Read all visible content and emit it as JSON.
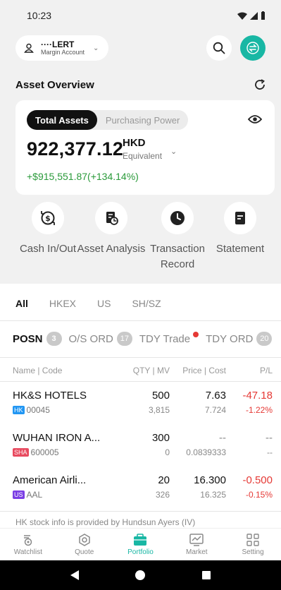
{
  "status": {
    "time": "10:23"
  },
  "account": {
    "name": "····LERT",
    "type": "Margin Account"
  },
  "overview": {
    "title": "Asset Overview",
    "tabs": [
      "Total Assets",
      "Purchasing Power"
    ],
    "amount": "922,377.12",
    "currency": "HKD",
    "equivalent": "Equivalent",
    "gain": "+$915,551.87(+134.14%)"
  },
  "actions": [
    {
      "label": "Cash In/Out",
      "icon": "cash-transfer-icon"
    },
    {
      "label": "Asset Analysis",
      "icon": "analysis-icon"
    },
    {
      "label": "Transaction Record",
      "icon": "clock-icon"
    },
    {
      "label": "Statement",
      "icon": "document-icon"
    }
  ],
  "market_tabs": [
    "All",
    "HKEX",
    "US",
    "SH/SZ"
  ],
  "sub_tabs": [
    {
      "label": "POSN",
      "count": "3"
    },
    {
      "label": "O/S ORD",
      "count": "17"
    },
    {
      "label": "TDY Trade",
      "count": ""
    },
    {
      "label": "TDY ORD",
      "count": "20"
    }
  ],
  "columns": {
    "name": "Name | Code",
    "qty": "QTY | MV",
    "price": "Price | Cost",
    "pl": "P/L"
  },
  "positions": [
    {
      "name": "HK&S HOTELS",
      "market": "HK",
      "code": "00045",
      "qty": "500",
      "mv": "3,815",
      "price": "7.63",
      "cost": "7.724",
      "pl": "-47.18",
      "pl_pct": "-1.22%"
    },
    {
      "name": "WUHAN IRON A...",
      "market": "SHA",
      "code": "600005",
      "qty": "300",
      "mv": "0",
      "price": "--",
      "cost": "0.0839333",
      "pl": "--",
      "pl_pct": "--"
    },
    {
      "name": "American Airli...",
      "market": "US",
      "code": "AAL",
      "qty": "20",
      "mv": "326",
      "price": "16.300",
      "cost": "16.325",
      "pl": "-0.500",
      "pl_pct": "-0.15%"
    }
  ],
  "info": "HK stock info is provided by Hundsun Ayers (IV)",
  "nav": [
    {
      "label": "Watchlist",
      "icon": "watchlist-icon"
    },
    {
      "label": "Quote",
      "icon": "quote-icon"
    },
    {
      "label": "Portfolio",
      "icon": "portfolio-icon"
    },
    {
      "label": "Market",
      "icon": "market-icon"
    },
    {
      "label": "Setting",
      "icon": "setting-icon"
    }
  ],
  "colors": {
    "accent": "#18b7a4",
    "gain": "#2a9a3a",
    "loss": "#e53935",
    "hk_tag": "#2196f3",
    "sha_tag": "#e84a5f",
    "us_tag": "#7b3fe4"
  }
}
